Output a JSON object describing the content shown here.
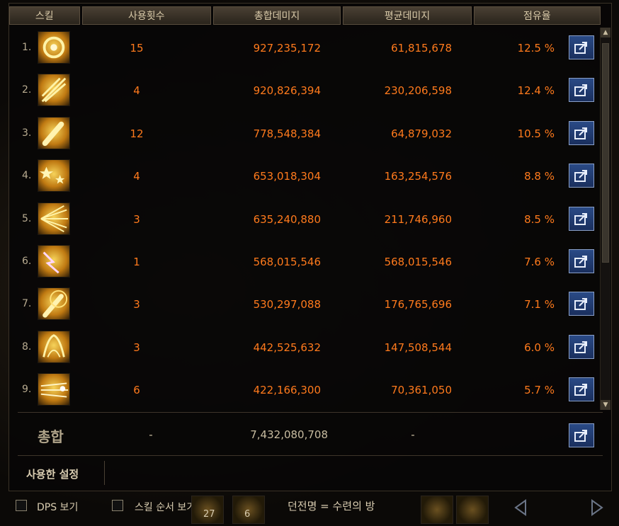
{
  "headers": {
    "skill": "스킬",
    "uses": "사용횟수",
    "total_damage": "총합데미지",
    "avg_damage": "평균데미지",
    "share": "점유율"
  },
  "rows": [
    {
      "rank": "1.",
      "icon": "skill-vortex-icon",
      "uses": "15",
      "total": "927,235,172",
      "avg": "61,815,678",
      "share": "12.5 %"
    },
    {
      "rank": "2.",
      "icon": "skill-slash-icon",
      "uses": "4",
      "total": "920,826,394",
      "avg": "230,206,598",
      "share": "12.4 %"
    },
    {
      "rank": "3.",
      "icon": "skill-club-icon",
      "uses": "12",
      "total": "778,548,384",
      "avg": "64,879,032",
      "share": "10.5 %"
    },
    {
      "rank": "4.",
      "icon": "skill-stars-icon",
      "uses": "4",
      "total": "653,018,304",
      "avg": "163,254,576",
      "share": "8.8 %"
    },
    {
      "rank": "5.",
      "icon": "skill-burst-icon",
      "uses": "3",
      "total": "635,240,880",
      "avg": "211,746,960",
      "share": "8.5 %"
    },
    {
      "rank": "6.",
      "icon": "skill-lightning-icon",
      "uses": "1",
      "total": "568,015,546",
      "avg": "568,015,546",
      "share": "7.6 %"
    },
    {
      "rank": "7.",
      "icon": "skill-club-strike-icon",
      "uses": "3",
      "total": "530,297,088",
      "avg": "176,765,696",
      "share": "7.1 %"
    },
    {
      "rank": "8.",
      "icon": "skill-flame-icon",
      "uses": "3",
      "total": "442,525,632",
      "avg": "147,508,544",
      "share": "6.0 %"
    },
    {
      "rank": "9.",
      "icon": "skill-streak-icon",
      "uses": "6",
      "total": "422,166,300",
      "avg": "70,361,050",
      "share": "5.7 %"
    }
  ],
  "total": {
    "label": "총합",
    "uses": "-",
    "total": "7,432,080,708",
    "avg": "-"
  },
  "settings_label": "사용한 설정",
  "bottom": {
    "dps_label": "DPS 보기",
    "skill_order_label": "스킬 순서 보기",
    "dungeon_text": "던전명 = 수련의 방",
    "hotkey_left": "27",
    "hotkey_right": "6"
  },
  "colors": {
    "value_orange": "#ff7a1c",
    "header_text": "#d8c9a8",
    "export_button_bg": "#22407a"
  }
}
